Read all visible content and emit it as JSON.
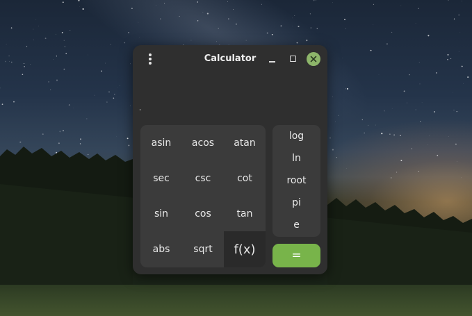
{
  "window": {
    "title": "Calculator",
    "display_value": ""
  },
  "icons": {
    "menu": "vertical-dots-icon",
    "minimize": "minimize-icon",
    "maximize": "maximize-icon",
    "close": "close-icon"
  },
  "functions": {
    "asin": "asin",
    "acos": "acos",
    "atan": "atan",
    "sec": "sec",
    "csc": "csc",
    "cot": "cot",
    "sin": "sin",
    "cos": "cos",
    "tan": "tan",
    "abs": "abs",
    "sqrt": "sqrt",
    "fx": "f(x)"
  },
  "constants": {
    "log": "log",
    "ln": "ln",
    "root": "root",
    "pi": "pi",
    "e": "e"
  },
  "equals_label": "=",
  "colors": {
    "window_bg": "#2f2f2f",
    "panel_bg": "#3b3b3b",
    "active_key_bg": "#2a2a2a",
    "accent_green": "#78b44a",
    "close_button": "#8db56a"
  }
}
